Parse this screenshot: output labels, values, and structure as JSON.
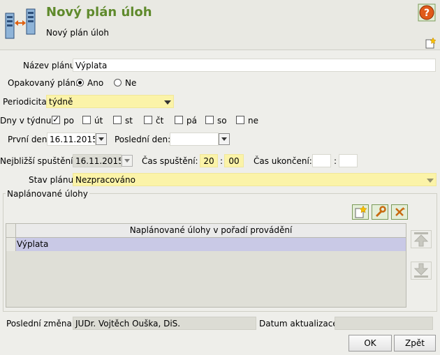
{
  "header": {
    "title": "Nový plán úloh",
    "subtitle": "Nový plán úloh"
  },
  "form": {
    "nazev_label": "Název plánu:",
    "nazev_value": "Výplata",
    "opakovany_label": "Opakovaný plán:",
    "opakovany_options": [
      "Ano",
      "Ne"
    ],
    "opakovany_selected": "Ano",
    "periodicita_label": "Periodicita:",
    "periodicita_value": "týdně",
    "dny_label": "Dny v týdnu:",
    "days": [
      {
        "label": "po",
        "checked": true
      },
      {
        "label": "út",
        "checked": false
      },
      {
        "label": "st",
        "checked": false
      },
      {
        "label": "čt",
        "checked": false
      },
      {
        "label": "pá",
        "checked": false
      },
      {
        "label": "so",
        "checked": false
      },
      {
        "label": "ne",
        "checked": false
      }
    ],
    "prvni_den_label": "První den:",
    "prvni_den_value": "16.11.2015",
    "posledni_den_label": "Poslední den:",
    "posledni_den_value": "",
    "nejblizsi_label": "Nejbližší spuštění:",
    "nejblizsi_value": "16.11.2015",
    "cas_spusteni_label": "Čas spuštění:",
    "cas_spusteni_h": "20",
    "cas_spusteni_m": "00",
    "cas_ukonceni_label": "Čas ukončení:",
    "cas_ukonceni_h": "",
    "cas_ukonceni_m": "",
    "time_sep": ":",
    "stav_label": "Stav plánu:",
    "stav_value": "Nezpracováno"
  },
  "tasks": {
    "group_label": "Naplánované úlohy",
    "column_header": "Naplánované úlohy v pořadí provádění",
    "rows": [
      "Výplata"
    ]
  },
  "footer": {
    "posledni_zmena_label": "Poslední změna:",
    "posledni_zmena_value": "JUDr. Vojtěch Ouška, DiS.",
    "datum_label": "Datum aktualizace:",
    "datum_value": "",
    "ok_label": "OK",
    "zpet_label": "Zpět"
  },
  "colors": {
    "title_green": "#5f8a2c",
    "yellow_field": "#fbf3a8",
    "selected_row": "#c9c9e6"
  }
}
